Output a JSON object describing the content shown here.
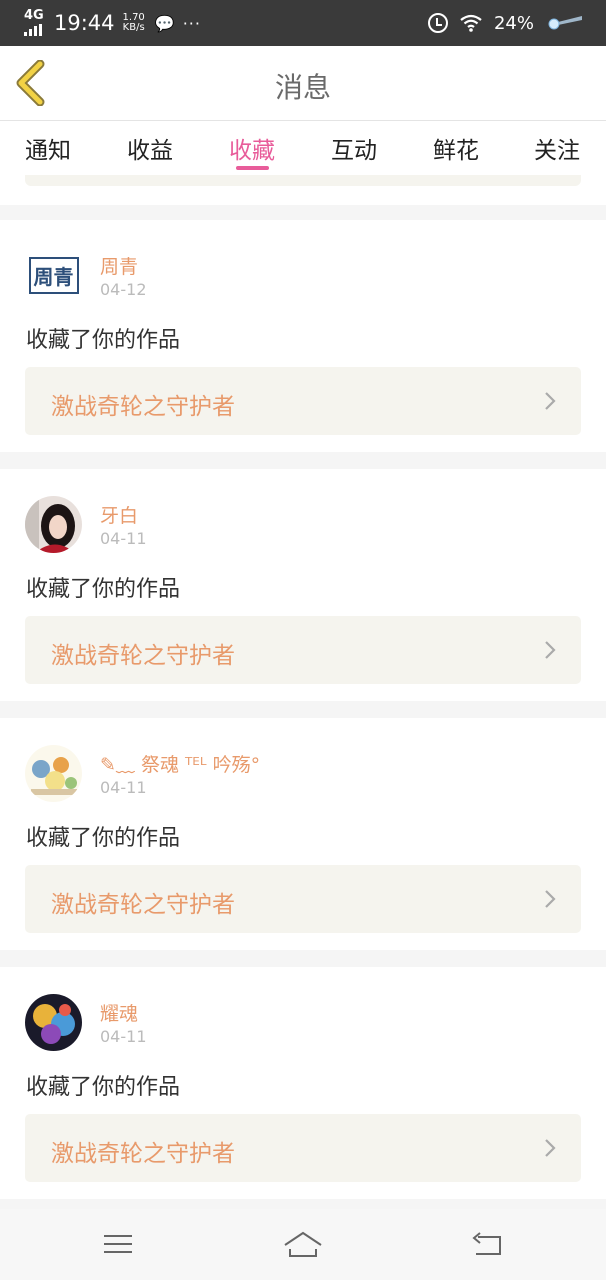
{
  "status_bar": {
    "network": "4G",
    "time": "19:44",
    "speed_value": "1.70",
    "speed_unit": "KB/s",
    "more": "···",
    "battery": "24%"
  },
  "header": {
    "title": "消息"
  },
  "tabs": [
    {
      "label": "通知",
      "active": false
    },
    {
      "label": "收益",
      "active": false
    },
    {
      "label": "收藏",
      "active": true
    },
    {
      "label": "互动",
      "active": false
    },
    {
      "label": "鲜花",
      "active": false
    },
    {
      "label": "关注",
      "active": false
    }
  ],
  "messages": [
    {
      "user": "周青",
      "avatar_text": "周青",
      "date": "04-12",
      "action": "收藏了你的作品",
      "work": "激战奇轮之守护者"
    },
    {
      "user": "牙白",
      "date": "04-11",
      "action": "收藏了你的作品",
      "work": "激战奇轮之守护者"
    },
    {
      "user": "✎﹏ 祭魂 ᵀᴱᴸ 吟殇°",
      "date": "04-11",
      "action": "收藏了你的作品",
      "work": "激战奇轮之守护者"
    },
    {
      "user": "耀魂",
      "date": "04-11",
      "action": "收藏了你的作品",
      "work": "激战奇轮之守护者"
    }
  ],
  "colors": {
    "accent": "#e85c9a",
    "name": "#e89a6b",
    "work_bg": "#f5f4ee"
  },
  "icons": [
    "back-icon",
    "chevron-right-icon",
    "menu-icon",
    "home-icon",
    "return-icon"
  ]
}
